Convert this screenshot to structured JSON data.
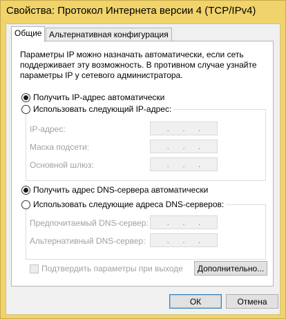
{
  "window": {
    "title": "Свойства: Протокол Интернета версии 4 (TCP/IPv4)"
  },
  "tabs": [
    {
      "label": "Общие",
      "active": true
    },
    {
      "label": "Альтернативная конфигурация",
      "active": false
    }
  ],
  "general": {
    "intro_text": "Параметры IP можно назначать автоматически, если сеть поддерживает эту возможность. В противном случае узнайте параметры IP у сетевого администратора.",
    "ip": {
      "auto_option": "Получить IP-адрес автоматически",
      "auto_selected": true,
      "manual_option": "Использовать следующий IP-адрес:",
      "manual_selected": false,
      "fields": [
        {
          "label": "IP-адрес:",
          "value": ". . ."
        },
        {
          "label": "Маска подсети:",
          "value": ". . ."
        },
        {
          "label": "Основной шлюз:",
          "value": ". . ."
        }
      ]
    },
    "dns": {
      "auto_option": "Получить адрес DNS-сервера автоматически",
      "auto_selected": true,
      "manual_option": "Использовать следующие адреса DNS-серверов:",
      "manual_selected": false,
      "fields": [
        {
          "label": "Предпочитаемый DNS-сервер:",
          "value": ". . ."
        },
        {
          "label": "Альтернативный DNS-сервер:",
          "value": ". . ."
        }
      ]
    },
    "validate_checkbox": "Подтвердить параметры при выходе",
    "validate_checked": false,
    "advanced_button": "Дополнительно..."
  },
  "buttons": {
    "ok": "ОК",
    "cancel": "Отмена"
  },
  "colors": {
    "titlebar": "#f0d36a",
    "disabled_text": "#a0a0a0",
    "default_button_border": "#3c7fb1"
  }
}
